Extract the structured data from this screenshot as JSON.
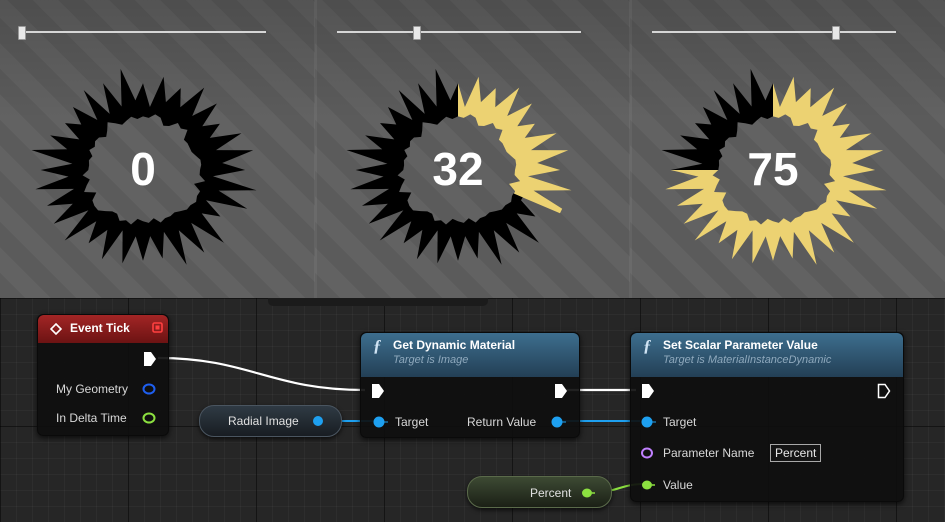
{
  "preview": {
    "panels": [
      {
        "value": "0",
        "fill_percent": 0
      },
      {
        "value": "32",
        "fill_percent": 32
      },
      {
        "value": "75",
        "fill_percent": 75
      }
    ],
    "fill_color": "#ecd272",
    "empty_color": "#000000"
  },
  "nodes": {
    "event_tick": {
      "title": "Event Tick",
      "pins": {
        "my_geometry": "My Geometry",
        "in_delta_time": "In Delta Time"
      }
    },
    "get_dynamic_material": {
      "title": "Get Dynamic Material",
      "subtitle": "Target is Image",
      "pins": {
        "target": "Target",
        "return_value": "Return Value"
      }
    },
    "set_scalar": {
      "title": "Set Scalar Parameter Value",
      "subtitle": "Target is MaterialInstanceDynamic",
      "pins": {
        "target": "Target",
        "parameter_name": "Parameter Name",
        "parameter_value": "Percent",
        "value": "Value"
      }
    },
    "radial_image_var": {
      "label": "Radial Image"
    },
    "percent_var": {
      "label": "Percent"
    }
  },
  "colors": {
    "exec_pin": "#ffffff",
    "object_pin": "#1ea0f0",
    "struct_pin": "#1e5ff0",
    "float_pin": "#8ce040",
    "name_pin": "#c080ff",
    "event_header": "#a32525",
    "function_header": "#3d6e8e"
  }
}
